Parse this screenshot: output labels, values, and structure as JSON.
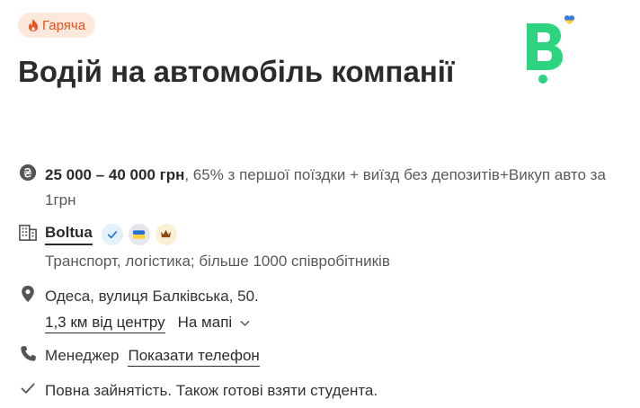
{
  "badge": {
    "label": "Гаряча",
    "icon": "fire-icon",
    "color": "#e9521c",
    "bg": "#fde8dc"
  },
  "logo": {
    "letter": "B",
    "brand_color": "#2dd47f",
    "icon": "ukraine-heart-icon"
  },
  "title": "Водій на автомобіль компанії",
  "salary": {
    "icon": "hryvnia-icon",
    "amount": "25 000 – 40 000 грн",
    "details": ", 65% з першої поїздки + виїзд без депозитів+Викуп авто за 1грн"
  },
  "company": {
    "icon": "building-icon",
    "name": "Boltua",
    "badges": [
      "verified-check-icon",
      "ukraine-flag-icon",
      "crown-icon"
    ],
    "description": "Транспорт, логістика; більше 1000 співробітників"
  },
  "location": {
    "icon": "map-pin-icon",
    "address": "Одеса, вулиця Балківська, 50.",
    "distance": "1,3 км від центру",
    "map_label": "На мапі"
  },
  "contact": {
    "icon": "phone-icon",
    "role": "Менеджер",
    "show_phone": "Показати телефон"
  },
  "employment": {
    "icon": "check-icon",
    "text": "Повна зайнятість. Також готові взяти студента."
  }
}
